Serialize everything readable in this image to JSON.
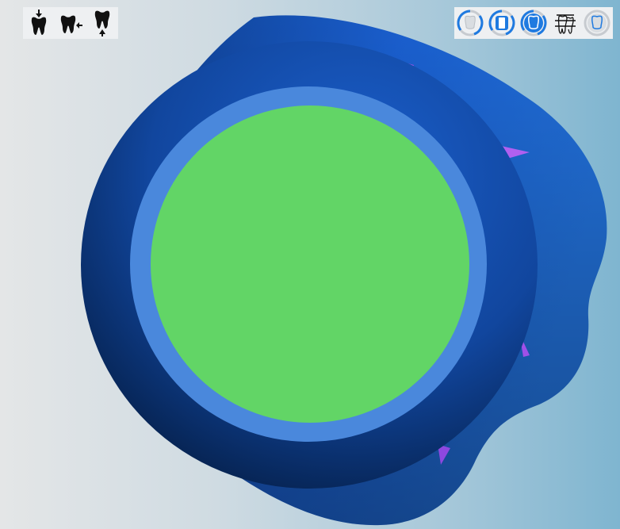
{
  "app": {
    "colors": {
      "background_left": "#e4e6e7",
      "background_right": "#7fb5d0",
      "model_dark": "#0a2e6e",
      "model_mid": "#1554c0",
      "model_light": "#1e6ad8",
      "rim": "#4a88dc",
      "occlusal_surface": "#62d566",
      "contact_marker": "#b060f0",
      "toolbar_bg": "#eef0f2",
      "icon_active": "#1f7ae0",
      "icon_inactive": "#c7cbd0"
    }
  },
  "view_toolbar": {
    "buttons": [
      {
        "icon": "tooth-top-view-icon"
      },
      {
        "icon": "tooth-side-view-icon"
      },
      {
        "icon": "tooth-bottom-view-icon"
      }
    ]
  },
  "mode_toolbar": {
    "buttons": [
      {
        "icon": "crown-outline-toggle-icon",
        "active": true
      },
      {
        "icon": "prep-margin-toggle-icon",
        "active": true
      },
      {
        "icon": "crown-solid-toggle-icon",
        "active": true
      },
      {
        "icon": "antagonist-bridge-icon",
        "active": false
      },
      {
        "icon": "crown-transparent-toggle-icon",
        "active": false
      }
    ]
  }
}
